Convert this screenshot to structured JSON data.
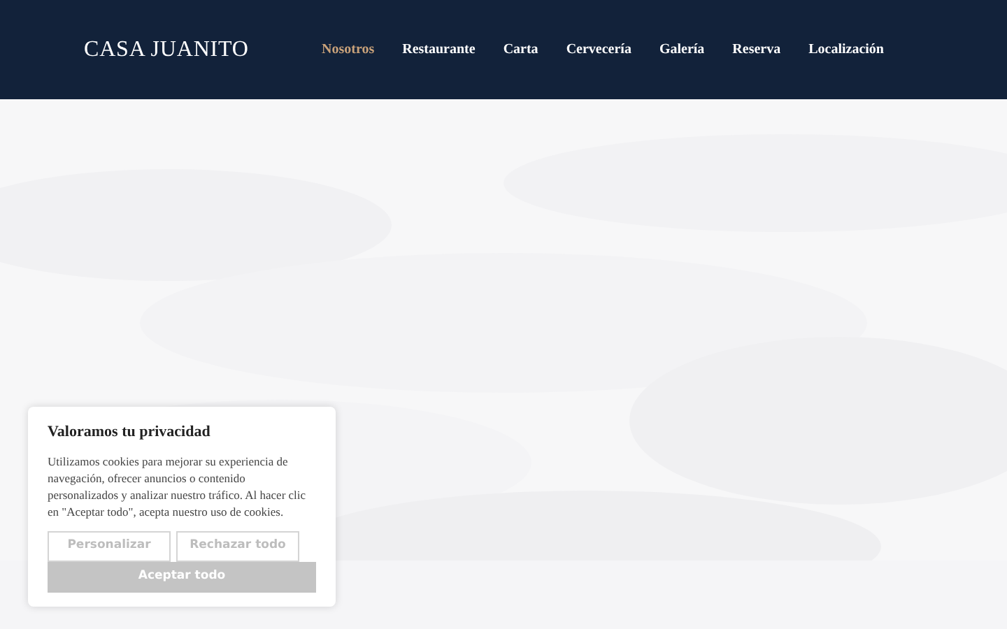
{
  "header": {
    "logo": "CASA JUANITO",
    "nav": [
      {
        "label": "Nosotros",
        "selected": true
      },
      {
        "label": "Restaurante",
        "selected": false
      },
      {
        "label": "Carta",
        "selected": false
      },
      {
        "label": "Cervecería",
        "selected": false
      },
      {
        "label": "Galería",
        "selected": false
      },
      {
        "label": "Reserva",
        "selected": false
      },
      {
        "label": "Localización",
        "selected": false
      }
    ]
  },
  "cookie_banner": {
    "title": "Valoramos tu privacidad",
    "text": "Utilizamos cookies para mejorar su experiencia de navegación, ofrecer anuncios o contenido personalizados y analizar nuestro tráfico. Al hacer clic en \"Aceptar todo\", acepta nuestro uso de cookies.",
    "buttons": [
      {
        "label": "Personalizar",
        "kind": "outline"
      },
      {
        "label": "Rechazar todo",
        "kind": "outline"
      },
      {
        "label": "Aceptar todo",
        "kind": "filled"
      }
    ]
  }
}
